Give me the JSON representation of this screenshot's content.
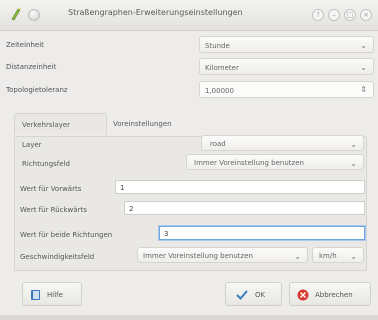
{
  "window": {
    "title": "Straßengraphen-Erweiterungseinstellungen"
  },
  "general": {
    "time_unit": {
      "label": "Zeiteinheit",
      "value": "Stunde"
    },
    "distance_unit": {
      "label": "Distanzeinheit",
      "value": "Kilometer"
    },
    "topology_tolerance": {
      "label": "Topologietoleranz",
      "value": "1,00000"
    }
  },
  "tabs": [
    {
      "label": "Verkehrslayer"
    },
    {
      "label": "Voreinstellungen"
    }
  ],
  "layer_tab": {
    "layer": {
      "label": "Layer",
      "value": "road"
    },
    "direction_field": {
      "label": "Richtungsfeld",
      "value": "Immer Voreinstellung benutzen"
    },
    "forward_value": {
      "label": "Wert für Vorwärts",
      "value": "1"
    },
    "backward_value": {
      "label": "Wert für Rückwärts",
      "value": "2"
    },
    "both_value": {
      "label": "Wert für beide Richtungen",
      "value": "3"
    },
    "speed_field": {
      "label": "Geschwindigkeitsfeld",
      "value": "Immer Voreinstellung benutzen",
      "unit": "km/h"
    }
  },
  "buttons": {
    "help": "Hilfe",
    "ok": "OK",
    "cancel": "Abbrechen"
  },
  "colors": {
    "focus": "#6fa4dd",
    "cancel_icon": "#d63b2f",
    "ok_icon": "#3b7fc4",
    "help_icon": "#3a78c2"
  }
}
